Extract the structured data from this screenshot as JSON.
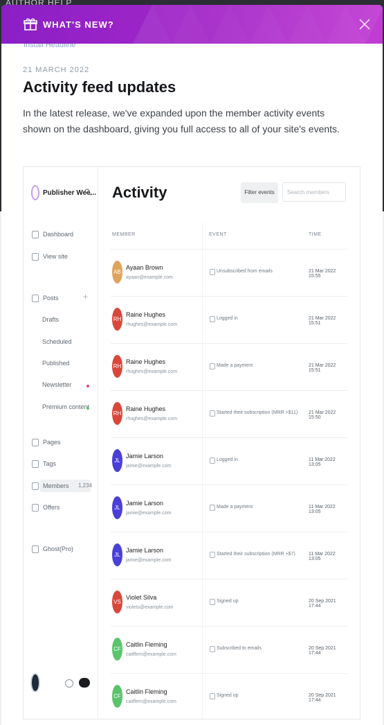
{
  "background": {
    "top_text": "AUTHOR    HELP"
  },
  "modal": {
    "header_title": "WHAT'S NEW?",
    "under_header_text": "Install Headline",
    "date": "21 MARCH 2022",
    "title": "Activity feed updates",
    "intro": "In the latest release, we've expanded upon the member activity events shown on the dashboard, giving you full access to all of your site's events.",
    "colors": {
      "header_start": "#8a1fc6",
      "header_end": "#c23dd3"
    }
  },
  "shot": {
    "brand_name": "Publisher Wee...",
    "nav": {
      "dashboard": "Dashboard",
      "view_site": "View site",
      "posts": "Posts",
      "drafts": "Drafts",
      "scheduled": "Scheduled",
      "published": "Published",
      "newsletter": "Newsletter",
      "premium": "Premium content",
      "pages": "Pages",
      "tags": "Tags",
      "members": "Members",
      "members_count": "1,234",
      "offers": "Offers",
      "ghost_pro": "Ghost(Pro)"
    },
    "main_title": "Activity",
    "filter_label": "Filter events",
    "search_placeholder": "Search members",
    "columns": {
      "member": "MEMBER",
      "event": "EVENT",
      "time": "TIME"
    },
    "rows": [
      {
        "initials": "AB",
        "name": "Ayaan Brown",
        "email": "ayaan@example.com",
        "event": "Unsubscribed from emails",
        "time": "21 Mar 2022 15:55",
        "color": "#e0a35b"
      },
      {
        "initials": "RH",
        "name": "Raine Hughes",
        "email": "rhughes@example.com",
        "event": "Logged in",
        "time": "21 Mar 2022 15:51",
        "color": "#d9473b"
      },
      {
        "initials": "RH",
        "name": "Raine Hughes",
        "email": "rhughes@example.com",
        "event": "Made a payment",
        "time": "21 Mar 2022 15:51",
        "color": "#d9473b"
      },
      {
        "initials": "RH",
        "name": "Raine Hughes",
        "email": "rhughes@example.com",
        "event": "Started their subscription (MRR +$11)",
        "time": "21 Mar 2022 15:50",
        "color": "#d9473b"
      },
      {
        "initials": "JL",
        "name": "Jamie Larson",
        "email": "jamie@example.com",
        "event": "Logged in",
        "time": "11 Mar 2022 13:05",
        "color": "#4a3fd8"
      },
      {
        "initials": "JL",
        "name": "Jamie Larson",
        "email": "jamie@example.com",
        "event": "Made a payment",
        "time": "11 Mar 2022 13:05",
        "color": "#4a3fd8"
      },
      {
        "initials": "JL",
        "name": "Jamie Larson",
        "email": "jamie@example.com",
        "event": "Started their subscription (MRR +$7)",
        "time": "11 Mar 2022 13:05",
        "color": "#4a3fd8"
      },
      {
        "initials": "VS",
        "name": "Violet Silva",
        "email": "violets@example.com",
        "event": "Signed up",
        "time": "20 Sep 2021 17:44",
        "color": "#d9473b"
      },
      {
        "initials": "CF",
        "name": "Caitlin Fleming",
        "email": "caitflem@example.com",
        "event": "Subscribed to emails",
        "time": "20 Sep 2021 17:44",
        "color": "#5ac46a"
      },
      {
        "initials": "CF",
        "name": "Caitlin Fleming",
        "email": "caitflem@example.com",
        "event": "Signed up",
        "time": "20 Sep 2021 17:44",
        "color": "#5ac46a"
      }
    ]
  }
}
